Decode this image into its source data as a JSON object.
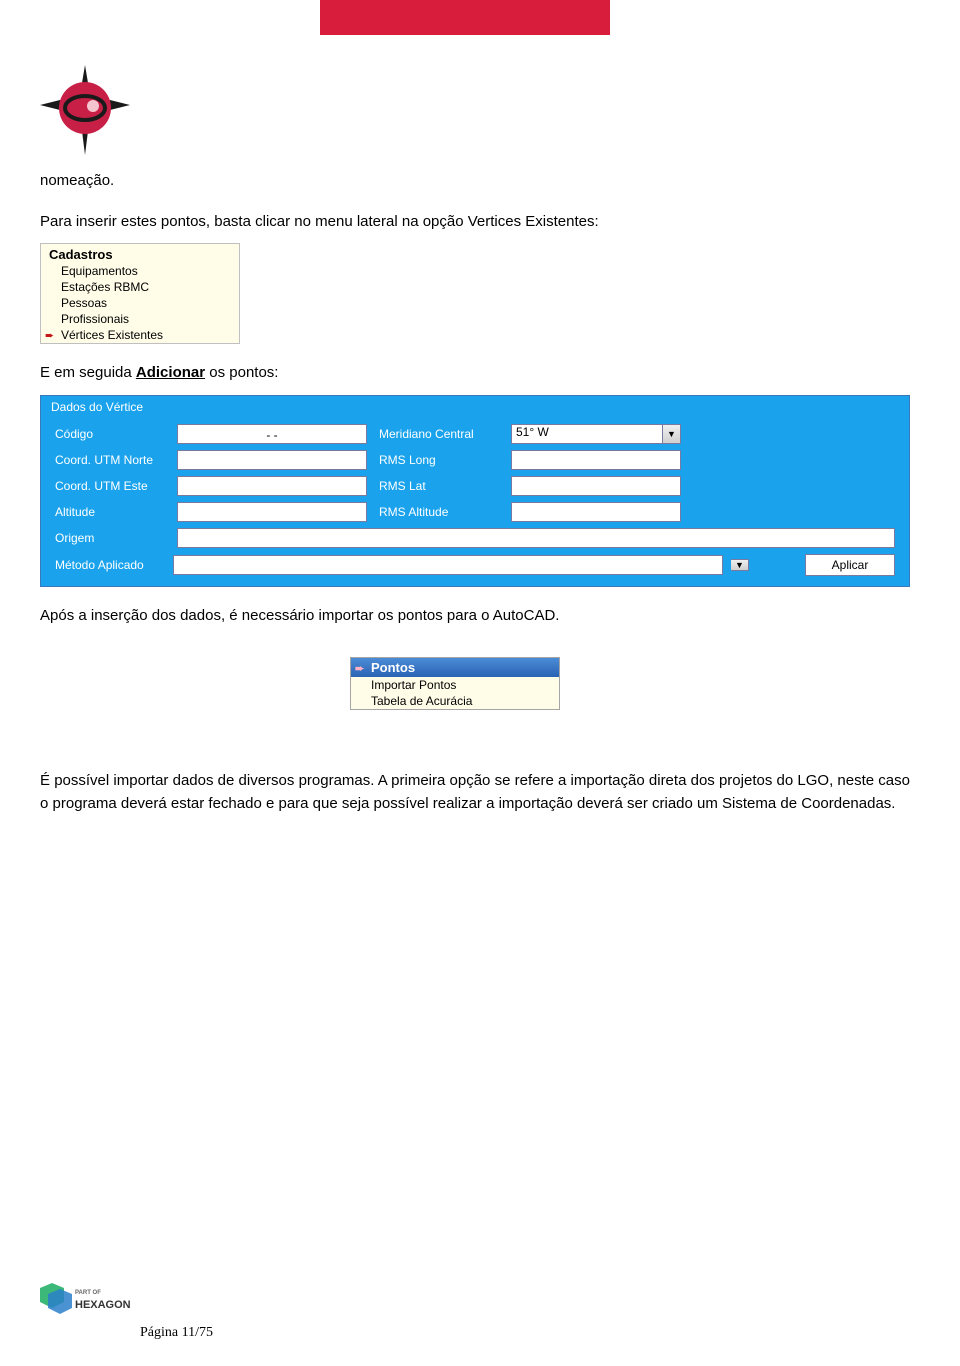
{
  "topbar": {},
  "text": {
    "p1": "nomeação.",
    "p2a": "Para inserir estes pontos, basta clicar no menu lateral na opção Vertices Existentes:",
    "p3a": "E em seguida ",
    "p3b": "Adicionar",
    "p3c": " os pontos:",
    "p4": "Após a inserção dos dados, é necessário importar os pontos para o AutoCAD.",
    "p5": "É possível importar dados de diversos programas. A primeira opção se refere a importação direta dos projetos do LGO, neste caso o programa deverá estar fechado e para que seja possível realizar a importação deverá ser criado um Sistema de Coordenadas."
  },
  "cadastros": {
    "title": "Cadastros",
    "items": [
      "Equipamentos",
      "Estações RBMC",
      "Pessoas",
      "Profissionais",
      "Vértices Existentes"
    ]
  },
  "vertice_form": {
    "legend": "Dados do Vértice",
    "codigo_label": "Código",
    "codigo_value": "- -",
    "meridiano_label": "Meridiano Central",
    "meridiano_value": "51° W",
    "norte_label": "Coord. UTM Norte",
    "rms_long_label": "RMS Long",
    "este_label": "Coord. UTM Este",
    "rms_lat_label": "RMS Lat",
    "altitude_label": "Altitude",
    "rms_alt_label": "RMS Altitude",
    "origem_label": "Origem",
    "metodo_label": "Método Aplicado",
    "aplicar": "Aplicar"
  },
  "pontos_menu": {
    "title": "Pontos",
    "items": [
      "Importar Pontos",
      "Tabela de Acurácia"
    ]
  },
  "footer": {
    "hexagon_top": "PART OF",
    "hexagon": "HEXAGON",
    "page_label": "Página ",
    "page": "11/75"
  }
}
